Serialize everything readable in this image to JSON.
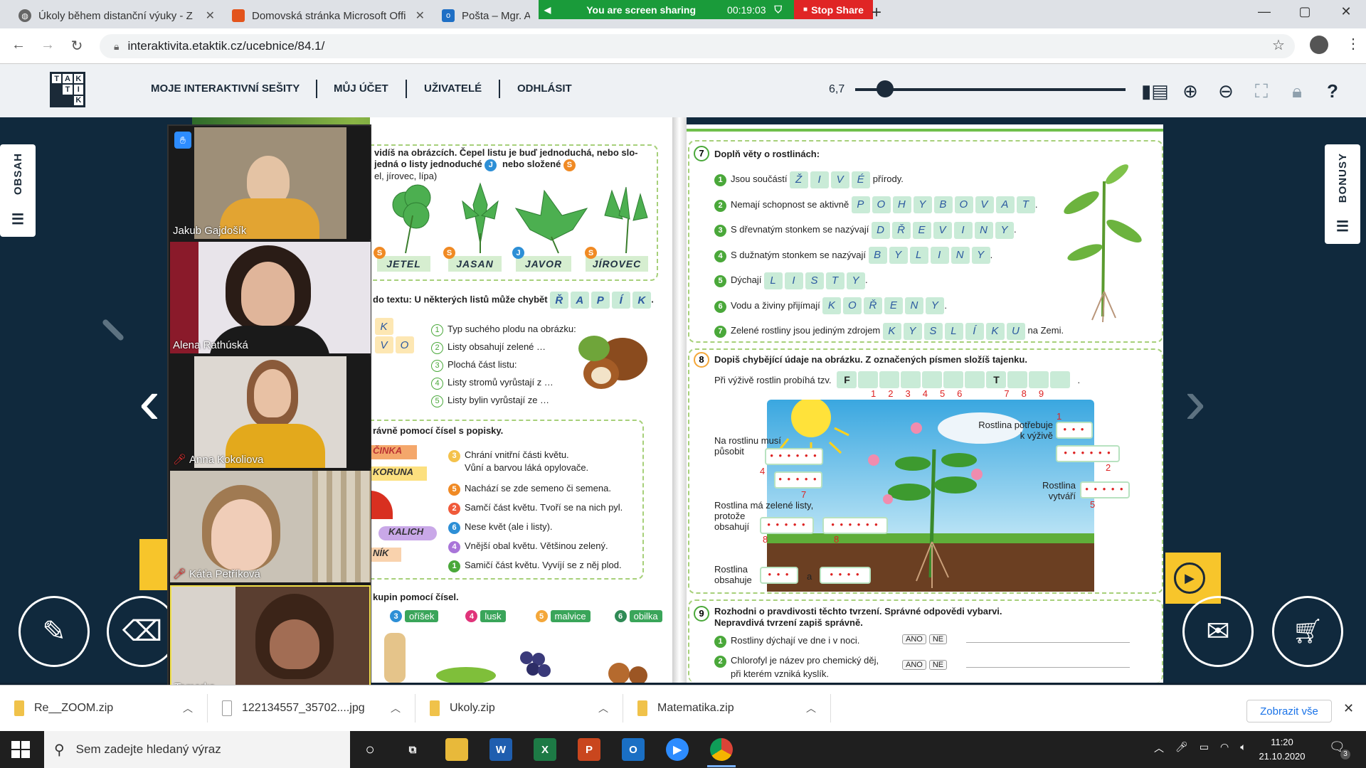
{
  "browser": {
    "tabs": [
      {
        "title": "Úkoly během distanční výuky - Z",
        "icon": "globe-icon"
      },
      {
        "title": "Domovská stránka Microsoft Offi",
        "icon": "office-icon"
      },
      {
        "title": "Pošta – Mgr. Al",
        "icon": "outlook-icon"
      }
    ],
    "url": "interaktivita.etaktik.cz/ucebnice/84.1/",
    "share_banner": {
      "text": "You are screen sharing",
      "timer": "00:19:03",
      "stop_label": "Stop Share"
    }
  },
  "app": {
    "logo_letters": [
      "T",
      "A",
      "K",
      "",
      "T",
      "I",
      "",
      "",
      "K"
    ],
    "menu": [
      "MOJE INTERAKTIVNÍ SEŠITY",
      "MŮJ ÚČET",
      "UŽIVATELÉ",
      "ODHLÁSIT"
    ],
    "zoom_value": "6,7",
    "zoom_fraction": 0.11,
    "side_left": "OBSAH",
    "side_right": "BONUSY"
  },
  "left_page": {
    "intro1": "vidíš na obrázcích. Čepel listu je buď jednoduchá, nebo slo-",
    "intro2a": "jedná o listy jednoduché",
    "intro2b": "nebo složené",
    "intro3": "el, jírovec, lípa)",
    "leaves": [
      "JETEL",
      "JASAN",
      "JAVOR",
      "JÍROVEC"
    ],
    "leaf_badges": [
      "S",
      "S",
      "J",
      "S"
    ],
    "text_prompt": "do textu: U některých listů může chybět",
    "rapik": [
      "Ř",
      "A",
      "P",
      "Í",
      "K"
    ],
    "crossword_letters": [
      "K",
      "V",
      "O"
    ],
    "clues": [
      "Typ suchého plodu na obrázku:",
      "Listy obsahují zelené …",
      "Plochá část listu:",
      "Listy stromů vyrůstají z …",
      "Listy bylin vyrůstají ze …"
    ],
    "flower_title": "rávně pomocí čísel s popisky.",
    "flower_labels": [
      "ČINKA",
      "KORUNA",
      "KALICH",
      "NÍK"
    ],
    "flower_clues": [
      {
        "n": "3",
        "t": "Chrání vnitřní části květu.",
        "t2": "Vůní a barvou láká opylovače."
      },
      {
        "n": "5",
        "t": "Nachází se zde semeno či semena."
      },
      {
        "n": "2",
        "t": "Samčí část květu. Tvoří se na nich pyl."
      },
      {
        "n": "6",
        "t": "Nese květ (ale i listy)."
      },
      {
        "n": "4",
        "t": "Vnější obal květu. Většinou zelený."
      },
      {
        "n": "1",
        "t": "Samičí část květu. Vyvíjí se z něj plod."
      }
    ],
    "groups_title": "kupin pomocí čísel.",
    "fruit_tags": [
      {
        "n": "3",
        "label": "oříšek",
        "color": "#3aa55a"
      },
      {
        "n": "4",
        "label": "lusk",
        "color": "#3aa55a"
      },
      {
        "n": "5",
        "label": "malvice",
        "color": "#3aa55a"
      },
      {
        "n": "6",
        "label": "obilka",
        "color": "#3aa55a"
      }
    ]
  },
  "right_page": {
    "ex7": {
      "num": "7",
      "title": "Doplň věty o rostlinách:",
      "rows": [
        {
          "n": "1",
          "pre": "Jsou součástí",
          "letters": [
            "Ž",
            "I",
            "V",
            "É"
          ],
          "post": "přírody."
        },
        {
          "n": "2",
          "pre": "Nemají schopnost se aktivně",
          "letters": [
            "P",
            "O",
            "H",
            "Y",
            "B",
            "O",
            "V",
            "A",
            "T"
          ],
          "post": "."
        },
        {
          "n": "3",
          "pre": "S dřevnatým stonkem se nazývají",
          "letters": [
            "D",
            "Ř",
            "E",
            "V",
            "I",
            "N",
            "Y"
          ],
          "post": "."
        },
        {
          "n": "4",
          "pre": "S dužnatým stonkem se nazývají",
          "letters": [
            "B",
            "Y",
            "L",
            "I",
            "N",
            "Y"
          ],
          "post": "."
        },
        {
          "n": "5",
          "pre": "Dýchají",
          "letters": [
            "L",
            "I",
            "S",
            "T",
            "Y"
          ],
          "post": "."
        },
        {
          "n": "6",
          "pre": "Vodu a živiny přijímají",
          "letters": [
            "K",
            "O",
            "Ř",
            "E",
            "N",
            "Y"
          ],
          "post": "."
        },
        {
          "n": "7",
          "pre": "Zelené rostliny jsou jediným zdrojem",
          "letters": [
            "K",
            "Y",
            "S",
            "L",
            "Í",
            "K",
            "U"
          ],
          "post": "na Zemi."
        }
      ]
    },
    "ex8": {
      "num": "8",
      "title": "Dopiš chybějící údaje na obrázku. Z označených písmen složíš tajenku.",
      "subtitle": "Při výživě rostlin probíhá tzv.",
      "cells": [
        "F",
        "",
        "",
        "",
        "",
        "",
        "",
        "T",
        "",
        "",
        ""
      ],
      "cell_nums": [
        "1",
        "2",
        "3",
        "4",
        "5",
        "6",
        "7",
        "8",
        "9"
      ],
      "labels": {
        "l1": "Na rostlinu musí",
        "l1b": "působit",
        "l2": "Rostlina má zelené listy,",
        "l2b": "protože",
        "l2c": "obsahují",
        "l3": "Rostlina",
        "l3b": "obsahuje",
        "l3and": "a",
        "r1": "Rostlina potřebuje",
        "r1b": "k výživě",
        "r2": "Rostlina",
        "r2b": "vytváří"
      },
      "marks": [
        "1",
        "2",
        "4",
        "5",
        "7",
        "8",
        "8"
      ]
    },
    "ex9": {
      "num": "9",
      "title": "Rozhodni o pravdivosti těchto tvrzení. Správné odpovědi vybarvi.",
      "subtitle": "Nepravdivá tvrzení zapiš správně.",
      "items": [
        {
          "n": "1",
          "t": "Rostliny dýchají ve dne i v noci."
        },
        {
          "n": "2",
          "t": "Chlorofyl je název pro chemický děj,",
          "t2": "při kterém vzniká kyslík."
        }
      ],
      "yes": "ANO",
      "no": "NE"
    }
  },
  "participants": [
    {
      "name": "Jakub Gajdošík",
      "muted": false,
      "raised_hand": true
    },
    {
      "name": "Alena Rathúská",
      "muted": false
    },
    {
      "name": "Anna Kokoliova",
      "muted": true
    },
    {
      "name": "Káťa Petříková",
      "muted": true
    },
    {
      "name": "Tamarka",
      "muted": false
    }
  ],
  "downloads": [
    {
      "name": "Re__ZOOM.zip"
    },
    {
      "name": "122134557_35702....jpg"
    },
    {
      "name": "Ukoly.zip"
    },
    {
      "name": "Matematika.zip"
    }
  ],
  "downloads_show_all": "Zobrazit vše",
  "taskbar": {
    "search_placeholder": "Sem zadejte hledaný výraz",
    "time": "11:20",
    "date": "21.10.2020",
    "notif_count": "3"
  }
}
